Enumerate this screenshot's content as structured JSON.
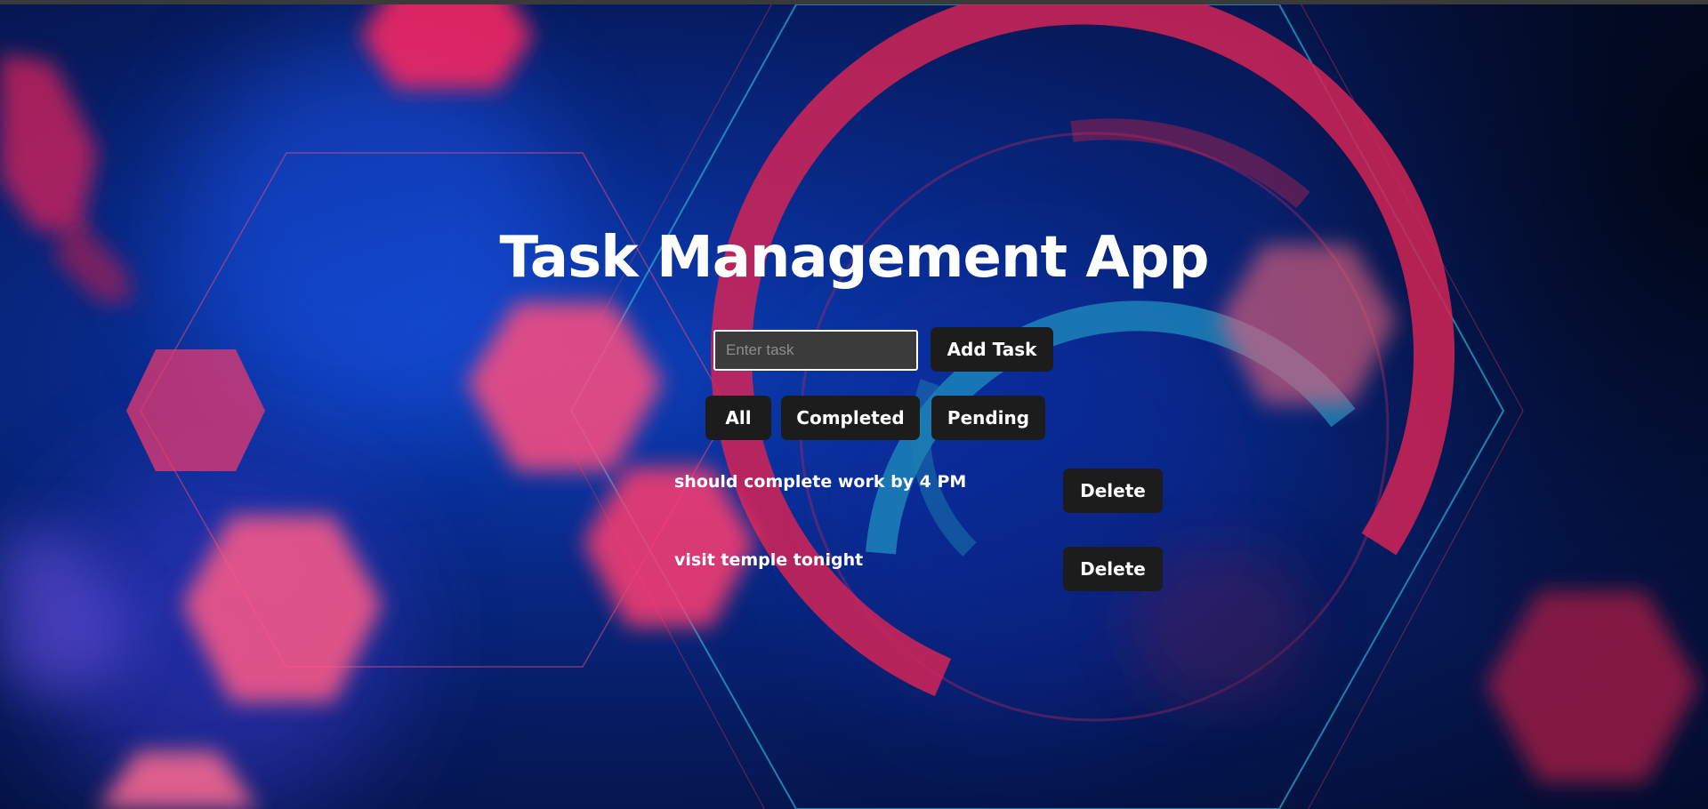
{
  "app": {
    "title": "Task Management App"
  },
  "input": {
    "placeholder": "Enter task",
    "value": ""
  },
  "buttons": {
    "add_label": "Add Task"
  },
  "filters": {
    "all_label": "All",
    "completed_label": "Completed",
    "pending_label": "Pending"
  },
  "tasks": [
    {
      "text": "should complete work by 4 PM",
      "delete_label": "Delete"
    },
    {
      "text": "visit temple tonight",
      "delete_label": "Delete"
    }
  ],
  "colors": {
    "background_primary": "#0a2f9a",
    "background_dark": "#030c2c",
    "accent_pink": "#e8245a",
    "accent_cyan": "#1aa3c9",
    "button_bg": "#1c1c1c",
    "input_bg": "#3b3b3b",
    "text": "#ffffff"
  }
}
